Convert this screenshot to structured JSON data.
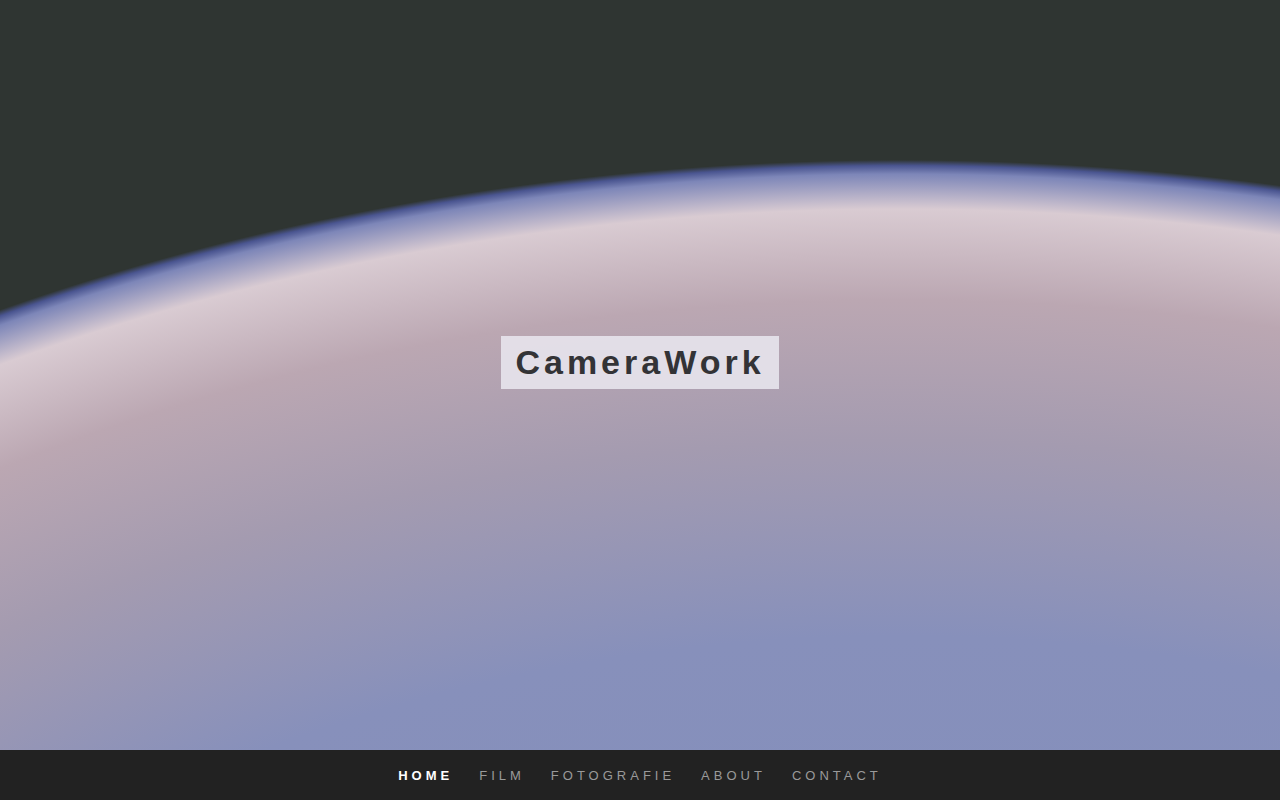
{
  "logo": {
    "text": "CameraWork"
  },
  "nav": {
    "items": [
      {
        "label": "HOME",
        "selected": true
      },
      {
        "label": "FILM",
        "selected": false
      },
      {
        "label": "FOTOGRAFIE",
        "selected": false
      },
      {
        "label": "ABOUT",
        "selected": false
      },
      {
        "label": "CONTACT",
        "selected": false
      }
    ]
  }
}
